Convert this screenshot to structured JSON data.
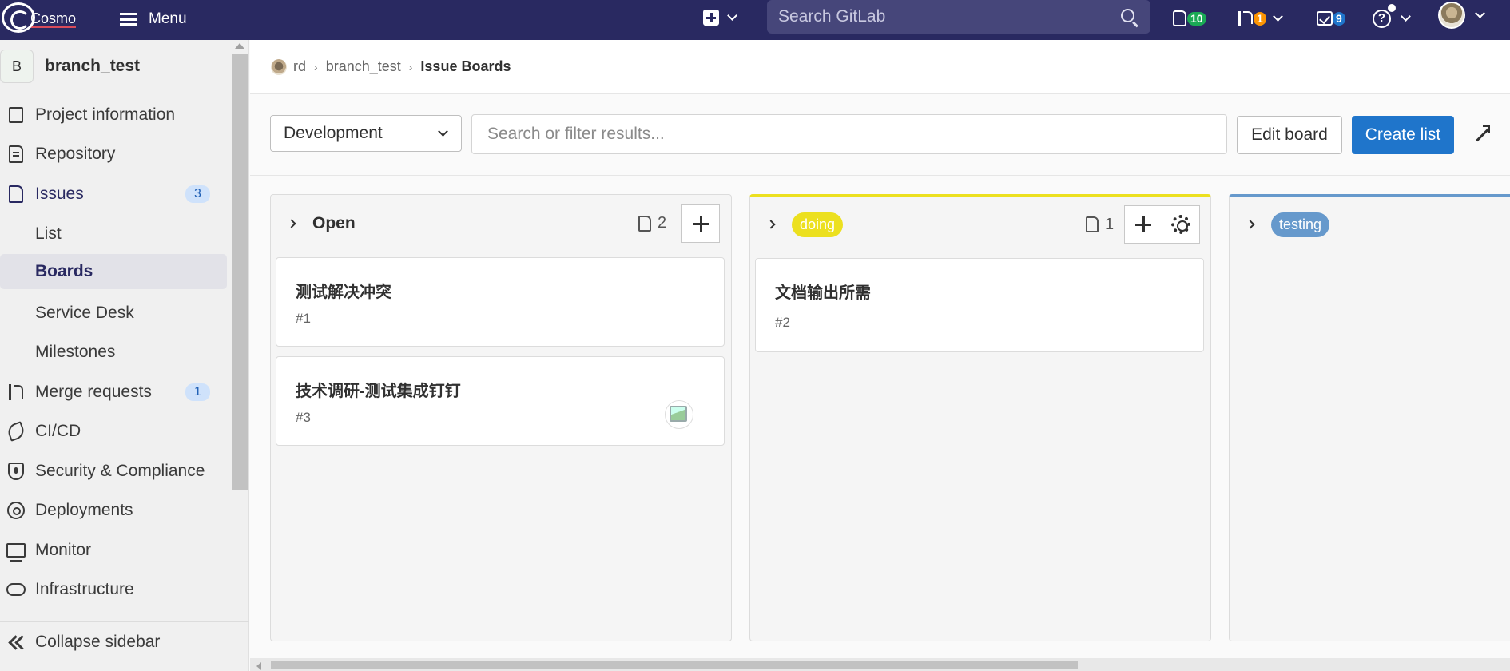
{
  "topbar": {
    "logo_text": "Cosmo",
    "menu_label": "Menu",
    "search_placeholder": "Search GitLab",
    "issues_count": "10",
    "mr_count": "1",
    "todo_count": "9",
    "help_symbol": "?",
    "colors": {
      "bg": "#292961",
      "issues_badge": "#1aaa55",
      "mr_badge": "#fc9403",
      "todo_badge": "#1f75cb"
    }
  },
  "sidebar": {
    "project_initial": "B",
    "project_name": "branch_test",
    "items": [
      {
        "label": "Project information",
        "icon": "project-info-icon"
      },
      {
        "label": "Repository",
        "icon": "repository-icon"
      },
      {
        "label": "Issues",
        "icon": "issues-icon",
        "badge": "3"
      },
      {
        "label": "List"
      },
      {
        "label": "Boards"
      },
      {
        "label": "Service Desk"
      },
      {
        "label": "Milestones"
      },
      {
        "label": "Merge requests",
        "icon": "merge-request-icon",
        "badge": "1"
      },
      {
        "label": "CI/CD",
        "icon": "rocket-icon"
      },
      {
        "label": "Security & Compliance",
        "icon": "shield-icon"
      },
      {
        "label": "Deployments",
        "icon": "deployments-icon"
      },
      {
        "label": "Monitor",
        "icon": "monitor-icon"
      },
      {
        "label": "Infrastructure",
        "icon": "cloud-icon"
      }
    ],
    "collapse_label": "Collapse sidebar"
  },
  "breadcrumb": {
    "group": "rd",
    "project": "branch_test",
    "current": "Issue Boards",
    "separator": "›"
  },
  "filters": {
    "board_name": "Development",
    "search_placeholder": "Search or filter results...",
    "edit_board_label": "Edit board",
    "create_list_label": "Create list"
  },
  "lists": [
    {
      "title": "Open",
      "count": "2",
      "cards": [
        {
          "title": "测试解决冲突",
          "number": "#1"
        },
        {
          "title": "技术调研-测试集成钉钉",
          "number": "#3"
        }
      ]
    },
    {
      "title": "doing",
      "label_color": "#ece01f",
      "count": "1",
      "cards": [
        {
          "title": "文档输出所需",
          "number": "#2"
        }
      ]
    },
    {
      "title": "testing",
      "label_color": "#6699cc",
      "cards": []
    }
  ]
}
